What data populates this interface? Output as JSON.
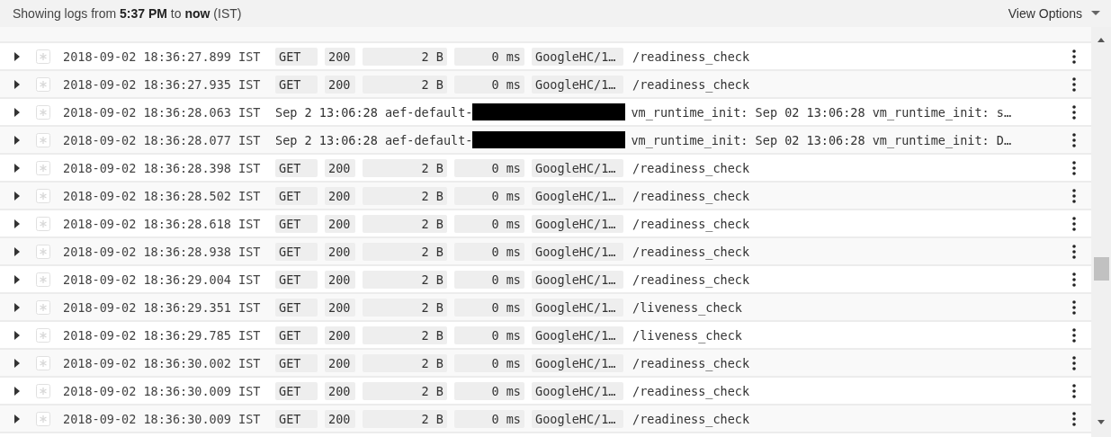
{
  "header": {
    "summary": "Showing logs from **5:37 PM** to **now** (IST)",
    "view_options": "View Options"
  },
  "rows": [
    {
      "kind": "request",
      "timestamp": "2018-09-02 18:36:27.899 IST",
      "method": "GET",
      "status": "200",
      "size": "2 B",
      "latency": "0 ms",
      "agent": "GoogleHC/1…",
      "path": "/readiness_check"
    },
    {
      "kind": "request",
      "timestamp": "2018-09-02 18:36:27.935 IST",
      "method": "GET",
      "status": "200",
      "size": "2 B",
      "latency": "0 ms",
      "agent": "GoogleHC/1…",
      "path": "/readiness_check"
    },
    {
      "kind": "text",
      "timestamp": "2018-09-02 18:36:28.063 IST",
      "prefix": "Sep 2 13:06:28 aef-default-",
      "redacted": true,
      "message": "vm_runtime_init: Sep 02 13:06:28 vm_runtime_init: s…"
    },
    {
      "kind": "text",
      "timestamp": "2018-09-02 18:36:28.077 IST",
      "prefix": "Sep 2 13:06:28 aef-default-",
      "redacted": true,
      "message": "vm_runtime_init: Sep 02 13:06:28 vm_runtime_init: D…"
    },
    {
      "kind": "request",
      "timestamp": "2018-09-02 18:36:28.398 IST",
      "method": "GET",
      "status": "200",
      "size": "2 B",
      "latency": "0 ms",
      "agent": "GoogleHC/1…",
      "path": "/readiness_check"
    },
    {
      "kind": "request",
      "timestamp": "2018-09-02 18:36:28.502 IST",
      "method": "GET",
      "status": "200",
      "size": "2 B",
      "latency": "0 ms",
      "agent": "GoogleHC/1…",
      "path": "/readiness_check"
    },
    {
      "kind": "request",
      "timestamp": "2018-09-02 18:36:28.618 IST",
      "method": "GET",
      "status": "200",
      "size": "2 B",
      "latency": "0 ms",
      "agent": "GoogleHC/1…",
      "path": "/readiness_check"
    },
    {
      "kind": "request",
      "timestamp": "2018-09-02 18:36:28.938 IST",
      "method": "GET",
      "status": "200",
      "size": "2 B",
      "latency": "0 ms",
      "agent": "GoogleHC/1…",
      "path": "/readiness_check"
    },
    {
      "kind": "request",
      "timestamp": "2018-09-02 18:36:29.004 IST",
      "method": "GET",
      "status": "200",
      "size": "2 B",
      "latency": "0 ms",
      "agent": "GoogleHC/1…",
      "path": "/readiness_check"
    },
    {
      "kind": "request",
      "timestamp": "2018-09-02 18:36:29.351 IST",
      "method": "GET",
      "status": "200",
      "size": "2 B",
      "latency": "0 ms",
      "agent": "GoogleHC/1…",
      "path": "/liveness_check"
    },
    {
      "kind": "request",
      "timestamp": "2018-09-02 18:36:29.785 IST",
      "method": "GET",
      "status": "200",
      "size": "2 B",
      "latency": "0 ms",
      "agent": "GoogleHC/1…",
      "path": "/liveness_check"
    },
    {
      "kind": "request",
      "timestamp": "2018-09-02 18:36:30.002 IST",
      "method": "GET",
      "status": "200",
      "size": "2 B",
      "latency": "0 ms",
      "agent": "GoogleHC/1…",
      "path": "/readiness_check"
    },
    {
      "kind": "request",
      "timestamp": "2018-09-02 18:36:30.009 IST",
      "method": "GET",
      "status": "200",
      "size": "2 B",
      "latency": "0 ms",
      "agent": "GoogleHC/1…",
      "path": "/readiness_check"
    },
    {
      "kind": "request",
      "timestamp": "2018-09-02 18:36:30.009 IST",
      "method": "GET",
      "status": "200",
      "size": "2 B",
      "latency": "0 ms",
      "agent": "GoogleHC/1…",
      "path": "/readiness_check"
    }
  ]
}
